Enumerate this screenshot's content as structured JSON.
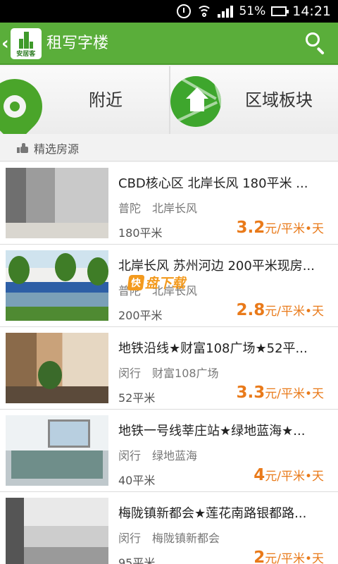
{
  "status_bar": {
    "battery_percent": "51%",
    "time": "14:21",
    "battery_level": 0.51
  },
  "header": {
    "logo_text": "安居客",
    "title": "租写字楼"
  },
  "categories": [
    {
      "label": "附近"
    },
    {
      "label": "区域板块"
    }
  ],
  "featured": {
    "label": "精选房源"
  },
  "listings": [
    {
      "title": "CBD核心区 北岸长风 180平米 ...",
      "district": "普陀",
      "area_name": "北岸长风",
      "size": "180平米",
      "price": "3.2",
      "unit": "元/平米•天"
    },
    {
      "title": "北岸长风 苏州河边 200平米现房...",
      "district": "普陀",
      "area_name": "北岸长风",
      "size": "200平米",
      "price": "2.8",
      "unit": "元/平米•天"
    },
    {
      "title": "地铁沿线★财富108广场★52平...",
      "district": "闵行",
      "area_name": "财富108广场",
      "size": "52平米",
      "price": "3.3",
      "unit": "元/平米•天"
    },
    {
      "title": "地铁一号线莘庄站★绿地蓝海★...",
      "district": "闵行",
      "area_name": "绿地蓝海",
      "size": "40平米",
      "price": "4",
      "unit": "元/平米•天"
    },
    {
      "title": "梅陇镇新都会★莲花南路银都路...",
      "district": "闵行",
      "area_name": "梅陇镇新都会",
      "size": "95平米",
      "price": "2",
      "unit": "元/平米•天"
    }
  ],
  "watermark": {
    "badge": "快",
    "text": "盘下载"
  },
  "colors": {
    "header_green": "#5aae3a",
    "price_orange": "#e97a1a",
    "icon_green": "#4aa52a"
  }
}
